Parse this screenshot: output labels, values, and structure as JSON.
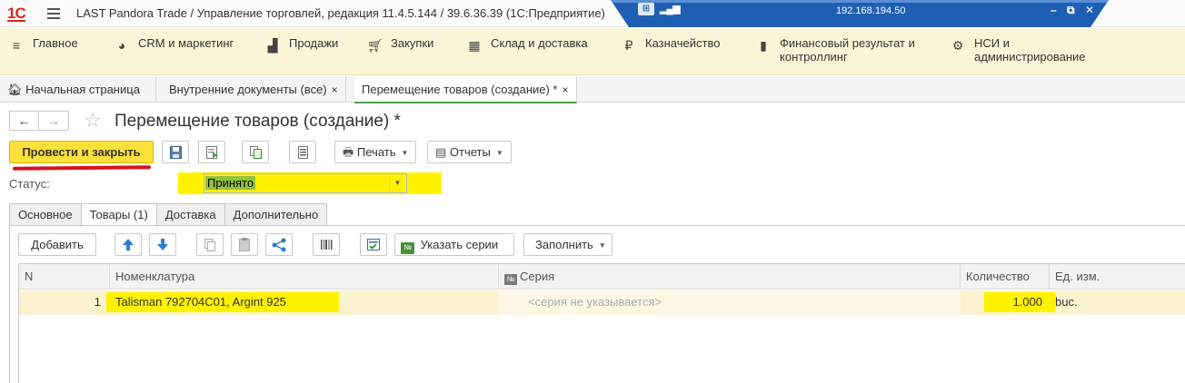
{
  "titlebar": {
    "logo": "1С",
    "app_title": "LAST Pandora Trade / Управление торговлей, редакция 11.4.5.144 / 39.6.36.39  (1С:Предприятие)",
    "remote_ip": "192.168.194.50",
    "minimize": "–",
    "restore": "⧉",
    "close": "✕"
  },
  "sections": [
    {
      "label": "Главное",
      "icon": "menu-icon"
    },
    {
      "label": "CRM и маркетинг",
      "icon": "crm-icon"
    },
    {
      "label": "Продажи",
      "icon": "bag-icon"
    },
    {
      "label": "Закупки",
      "icon": "cart-icon"
    },
    {
      "label": "Склад и доставка",
      "icon": "warehouse-icon"
    },
    {
      "label": "Казначейство",
      "icon": "ruble-icon"
    },
    {
      "label": "Финансовый результат и контроллинг",
      "icon": "chart-icon"
    },
    {
      "label": "НСИ и администрирование",
      "icon": "gear-icon"
    }
  ],
  "open_tabs": {
    "home": "Начальная страница",
    "tab1": "Внутренние документы (все)",
    "tab2": "Перемещение товаров (создание) *",
    "close": "×"
  },
  "form": {
    "title": "Перемещение товаров (создание) *",
    "post_and_close": "Провести и закрыть",
    "print": "Печать",
    "reports": "Отчеты",
    "status_label": "Статус:",
    "status_value": "Принято",
    "tabs": [
      "Основное",
      "Товары (1)",
      "Доставка",
      "Дополнительно"
    ],
    "active_tab": 1
  },
  "grid_toolbar": {
    "add": "Добавить",
    "specify_series": "Указать серии",
    "fill": "Заполнить"
  },
  "table": {
    "columns": [
      "N",
      "Номенклатура",
      "Серия",
      "Количество",
      "Ед. изм."
    ],
    "rows": [
      {
        "n": "1",
        "item": "Talisman 792704C01,  Argint 925",
        "series": "<серия не указывается>",
        "qty": "1.000",
        "unit": "buc."
      }
    ]
  },
  "colors": {
    "sections_bg": "#fbf5d8",
    "primary_button": "#fce13a",
    "highlight": "#fff200",
    "active_tab_underline": "#5a9c52",
    "row_selected": "#fbf3cf"
  }
}
